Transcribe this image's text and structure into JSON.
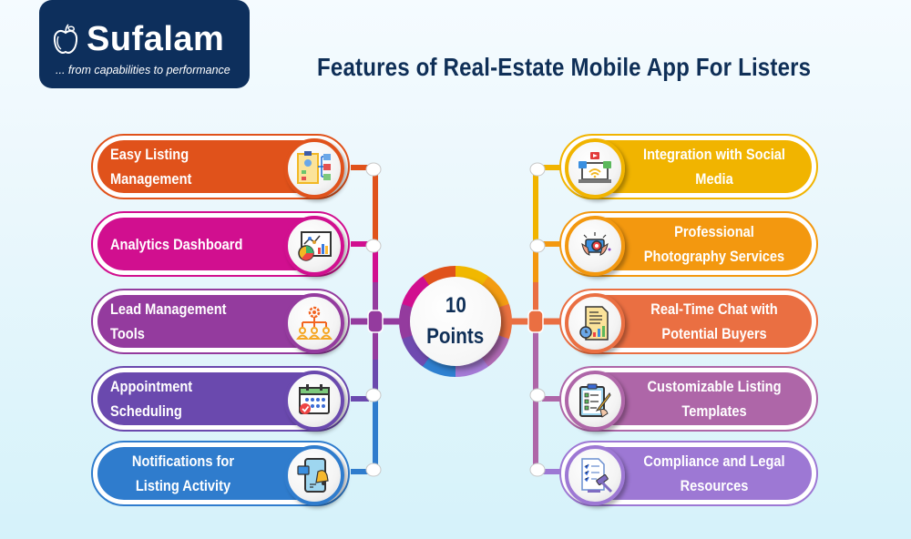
{
  "logo": {
    "brand": "Sufalam",
    "tagline": "... from capabilities to performance"
  },
  "title": "Features of Real-Estate Mobile App For Listers",
  "center": {
    "line1": "10",
    "line2": "Points"
  },
  "left_features": [
    {
      "label": "Easy Listing Management",
      "icon": "listing-management-icon",
      "color": "#e0521b"
    },
    {
      "label": "Analytics Dashboard",
      "icon": "analytics-dashboard-icon",
      "color": "#d10f8f"
    },
    {
      "label": "Lead Management Tools",
      "icon": "lead-management-icon",
      "color": "#943b9e"
    },
    {
      "label": "Appointment Scheduling",
      "icon": "calendar-icon",
      "color": "#6a49ae"
    },
    {
      "label": "Notifications for Listing Activity",
      "icon": "mobile-notification-icon",
      "color": "#2f7ccd"
    }
  ],
  "right_features": [
    {
      "label": "Integration with Social Media",
      "icon": "social-media-laptop-icon",
      "color": "#f1b400"
    },
    {
      "label": "Professional Photography Services",
      "icon": "camera-photography-icon",
      "color": "#f3980f"
    },
    {
      "label": "Real-Time Chat with Potential Buyers",
      "icon": "chat-document-icon",
      "color": "#ea6f42"
    },
    {
      "label": "Customizable Listing Templates",
      "icon": "clipboard-checklist-icon",
      "color": "#ae66a8"
    },
    {
      "label": "Compliance and Legal Resources",
      "icon": "legal-document-gavel-icon",
      "color": "#9d78d4"
    }
  ]
}
